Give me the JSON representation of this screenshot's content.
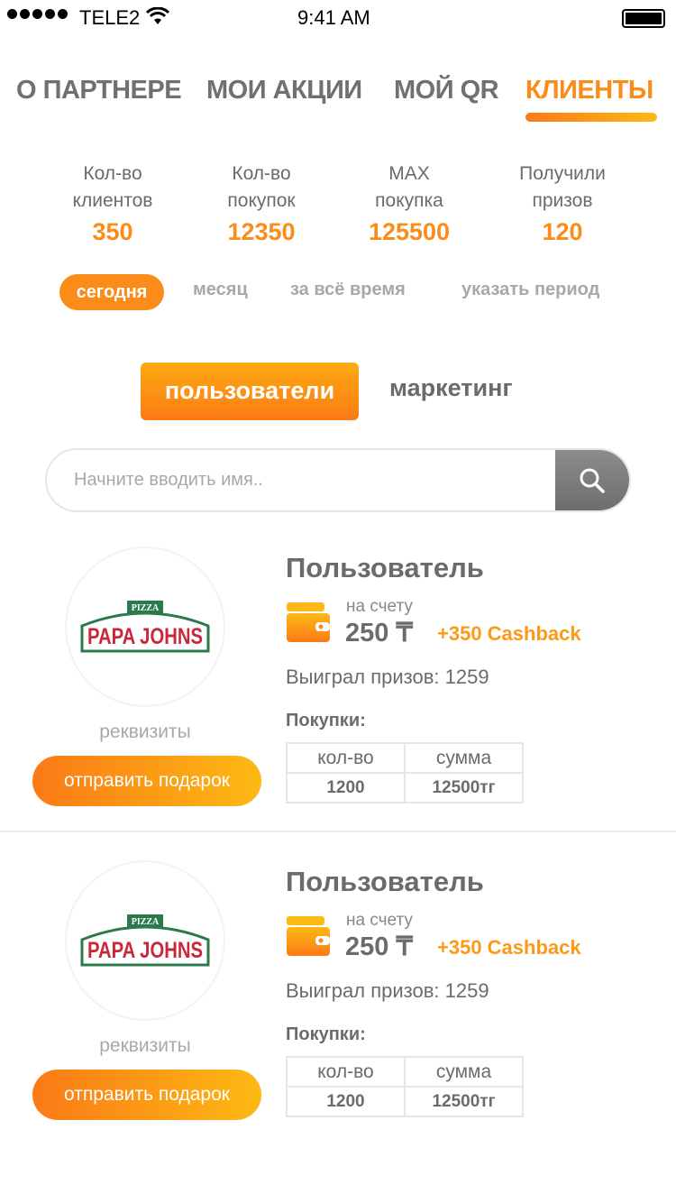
{
  "status_bar": {
    "carrier": "TELE2",
    "time": "9:41 AM"
  },
  "tabs": [
    {
      "label": "О ПАРТНЕРЕ"
    },
    {
      "label": "МОИ АКЦИИ"
    },
    {
      "label": "МОЙ QR"
    },
    {
      "label": "КЛИЕНТЫ",
      "active": true
    }
  ],
  "stats": [
    {
      "line1": "Кол-во",
      "line2": "клиентов",
      "value": "350"
    },
    {
      "line1": "Кол-во",
      "line2": "покупок",
      "value": "12350"
    },
    {
      "line1": "MAX",
      "line2": "покупка",
      "value": "125500"
    },
    {
      "line1": "Получили",
      "line2": "призов",
      "value": "120"
    }
  ],
  "periods": [
    "сегодня",
    "месяц",
    "за всё время",
    "указать период"
  ],
  "segments": [
    "пользователи",
    "маркетинг"
  ],
  "search": {
    "placeholder": "Начните вводить имя.."
  },
  "users": [
    {
      "logo": "PAPA JOHNS PIZZA",
      "name": "Пользователь",
      "balance_label": "на счету",
      "balance": "250 ₸",
      "cashback": "+350 Cashback",
      "prizes": "Выиграл призов: 1259",
      "purchases_label": "Покупки:",
      "col_count": "кол-во",
      "col_sum": "сумма",
      "count": "1200",
      "sum": "12500тг",
      "details": "реквизиты",
      "gift": "отправить подарок"
    },
    {
      "logo": "PAPA JOHNS PIZZA",
      "name": "Пользователь",
      "balance_label": "на счету",
      "balance": "250 ₸",
      "cashback": "+350 Cashback",
      "prizes": "Выиграл призов: 1259",
      "purchases_label": "Покупки:",
      "col_count": "кол-во",
      "col_sum": "сумма",
      "count": "1200",
      "sum": "12500тг",
      "details": "реквизиты",
      "gift": "отправить подарок"
    }
  ],
  "colors": {
    "accent": "#fb8c1a",
    "gradient_start": "#fb7a16",
    "gradient_end": "#fdb914"
  }
}
